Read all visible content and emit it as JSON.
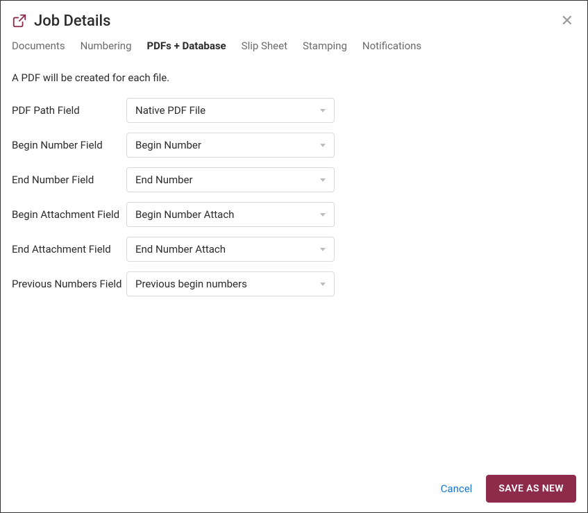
{
  "header": {
    "title": "Job Details"
  },
  "tabs": [
    {
      "label": "Documents",
      "active": false
    },
    {
      "label": "Numbering",
      "active": false
    },
    {
      "label": "PDFs + Database",
      "active": true
    },
    {
      "label": "Slip Sheet",
      "active": false
    },
    {
      "label": "Stamping",
      "active": false
    },
    {
      "label": "Notifications",
      "active": false
    }
  ],
  "intro_text": "A PDF will be created for each file.",
  "fields": {
    "pdf_path": {
      "label": "PDF Path Field",
      "value": "Native PDF File"
    },
    "begin_number": {
      "label": "Begin Number Field",
      "value": "Begin Number"
    },
    "end_number": {
      "label": "End Number Field",
      "value": "End Number"
    },
    "begin_attach": {
      "label": "Begin Attachment Field",
      "value": "Begin Number Attach"
    },
    "end_attach": {
      "label": "End Attachment Field",
      "value": "End Number Attach"
    },
    "prev_numbers": {
      "label": "Previous Numbers Field",
      "value": "Previous begin numbers"
    }
  },
  "footer": {
    "cancel_label": "Cancel",
    "save_label": "SAVE AS NEW"
  }
}
